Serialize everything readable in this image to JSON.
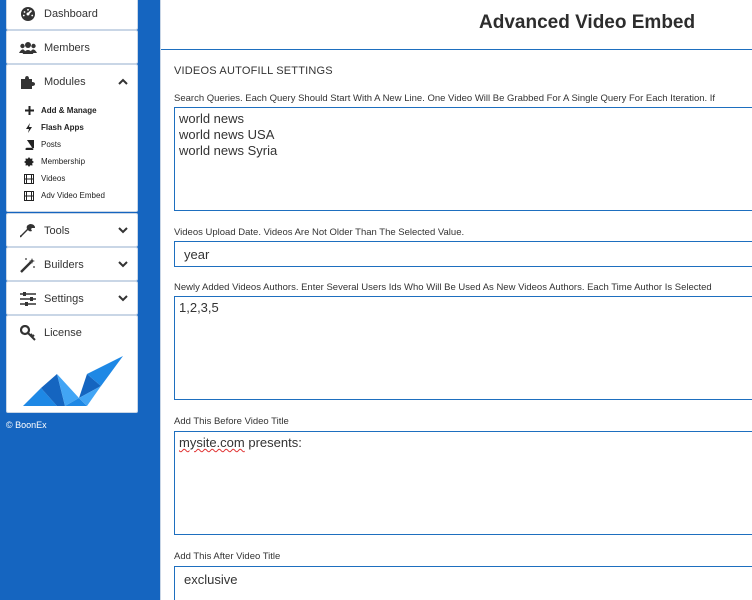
{
  "sidebar": {
    "top_items": [
      {
        "label": "Dashboard",
        "icon": "dashboard-icon"
      },
      {
        "label": "Members",
        "icon": "members-icon"
      }
    ],
    "modules": {
      "label": "Modules",
      "icon": "puzzle-icon",
      "expanded": true,
      "sub_items": [
        {
          "label": "Add & Manage",
          "icon": "plus-icon"
        },
        {
          "label": "Flash Apps",
          "icon": "bolt-icon"
        },
        {
          "label": "Posts",
          "icon": "book-icon"
        },
        {
          "label": "Membership",
          "icon": "badge-icon"
        },
        {
          "label": "Videos",
          "icon": "film-icon"
        },
        {
          "label": "Adv Video Embed",
          "icon": "film-icon"
        }
      ]
    },
    "bottom_items": [
      {
        "label": "Tools",
        "icon": "wrench-icon"
      },
      {
        "label": "Builders",
        "icon": "magic-icon"
      },
      {
        "label": "Settings",
        "icon": "sliders-icon"
      },
      {
        "label": "License",
        "icon": "key-icon"
      }
    ],
    "copyright": "© BoonEx"
  },
  "header": {
    "title": "Advanced Video Embed"
  },
  "section": {
    "title": "VIDEOS AUTOFILL SETTINGS"
  },
  "fields": {
    "queries": {
      "label": "Search Queries. Each Query Should Start With A New Line. One Video Will Be Grabbed For A Single Query For Each Iteration. If",
      "value": "world news\nworld news USA\nworld news Syria"
    },
    "upload_date": {
      "label": "Videos Upload Date. Videos Are Not Older Than The Selected Value.",
      "value": "year"
    },
    "authors": {
      "label": "Newly Added Videos Authors. Enter Several Users Ids Who Will Be Used As New Videos Authors. Each Time Author Is Selected",
      "value": "1,2,3,5"
    },
    "before_title": {
      "label": "Add This Before Video Title",
      "value_word": "mysite.com",
      "value_rest": " presents:"
    },
    "after_title": {
      "label": "Add This After Video Title",
      "value": "exclusive"
    }
  },
  "colors": {
    "sidebar": "#1565c0",
    "accent": "#1e6fbf"
  }
}
